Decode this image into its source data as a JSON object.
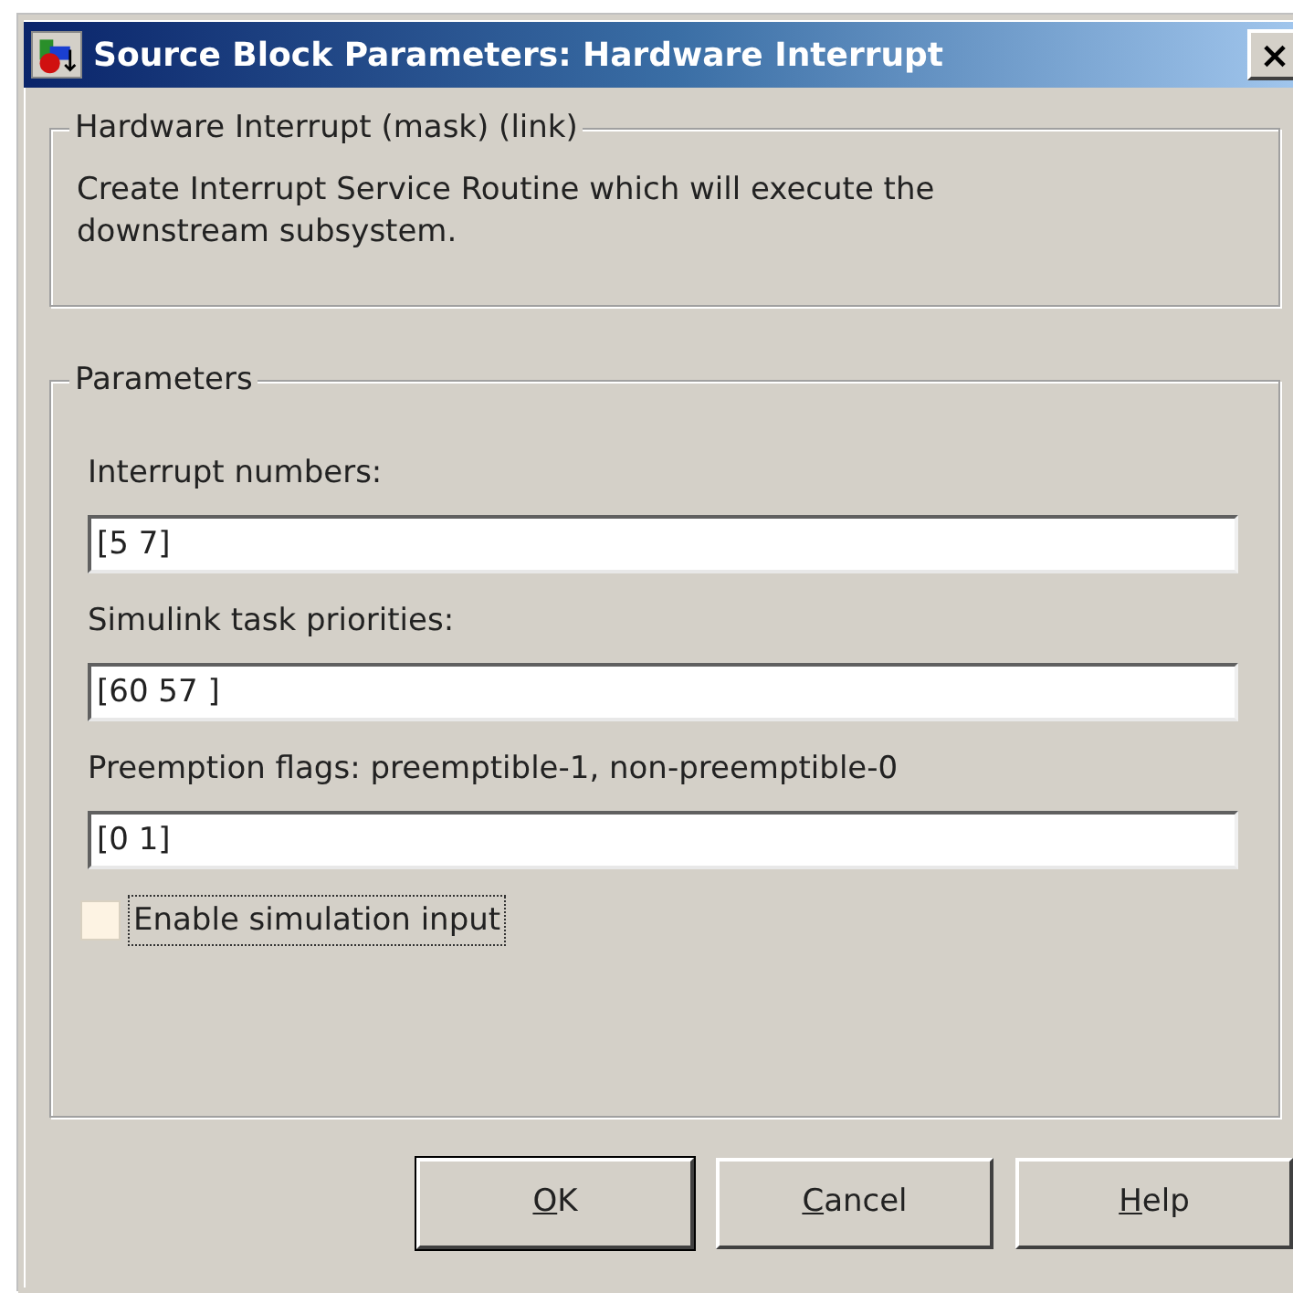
{
  "window": {
    "title": "Source Block Parameters: Hardware Interrupt",
    "close": "×"
  },
  "description_group": {
    "title": "Hardware Interrupt (mask) (link)",
    "text": "Create Interrupt Service Routine which will execute the downstream subsystem."
  },
  "parameters_group": {
    "title": "Parameters",
    "fields": [
      {
        "label": "Interrupt numbers:",
        "value": "[5 7]"
      },
      {
        "label": "Simulink task priorities:",
        "value": "[60 57 ]"
      },
      {
        "label": "Preemption flags: preemptible-1, non-preemptible-0",
        "value": "[0 1]"
      }
    ],
    "checkbox": {
      "label": "Enable simulation input",
      "checked": false,
      "focused": true
    }
  },
  "buttons": [
    {
      "label": "OK",
      "first_letter_underlined": true,
      "default": true
    },
    {
      "label": "Cancel",
      "first_letter_underlined": true,
      "default": false
    },
    {
      "label": "Help",
      "first_letter_underlined": true,
      "default": false
    }
  ]
}
